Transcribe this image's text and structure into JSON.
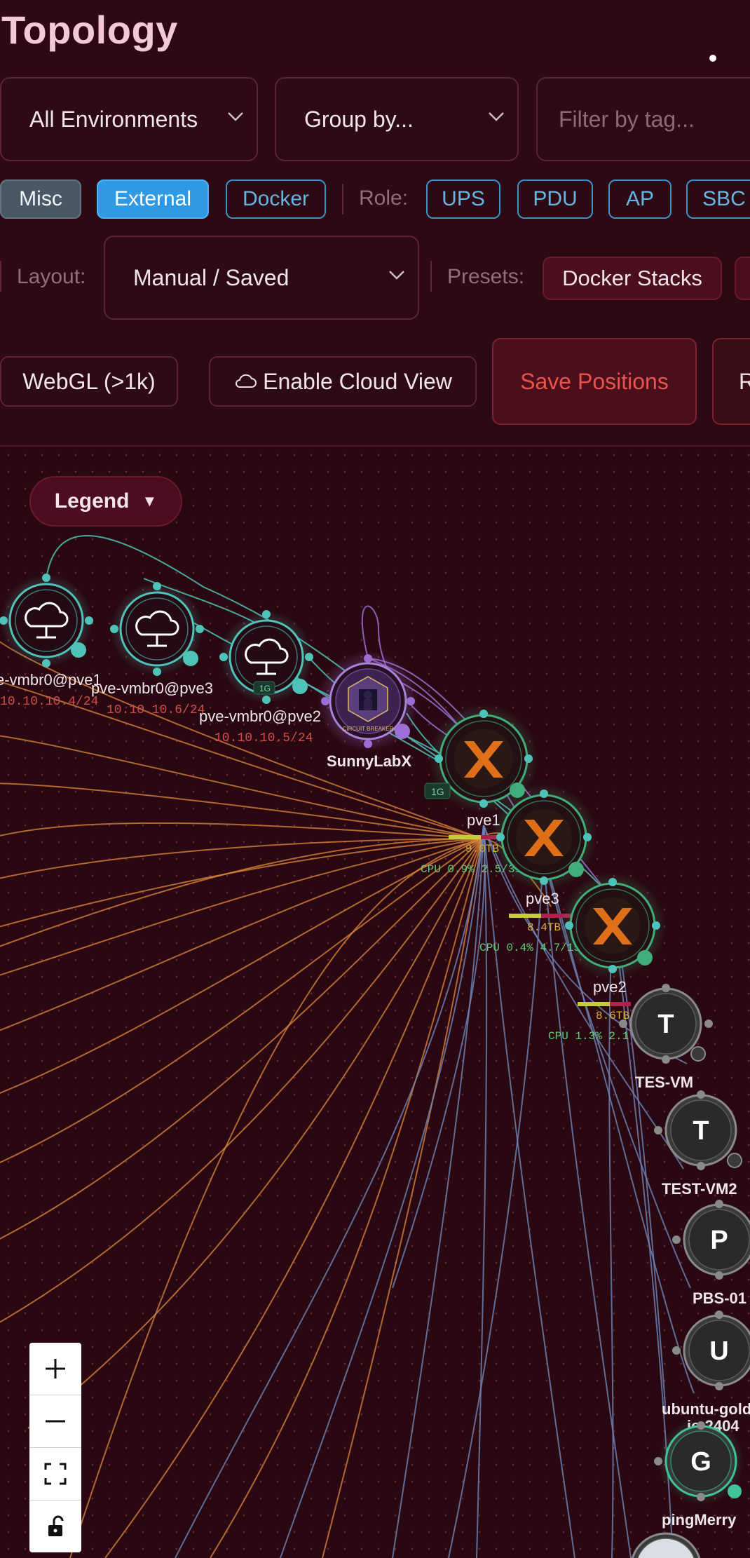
{
  "header": {
    "title": "Topology"
  },
  "filters": {
    "environment": "All Environments",
    "group_by": "Group by...",
    "tag_placeholder": "Filter by tag..."
  },
  "chips": {
    "misc": "Misc",
    "external": "External",
    "docker": "Docker",
    "role_label": "Role:",
    "roles": [
      "UPS",
      "PDU",
      "AP",
      "SBC"
    ]
  },
  "layout": {
    "label": "Layout:",
    "value": "Manual / Saved",
    "presets_label": "Presets:",
    "preset_docker": "Docker Stacks"
  },
  "actions": {
    "webgl": "WebGL (>1k)",
    "cloud": "Enable Cloud View",
    "save": "Save Positions",
    "next_partial": "R"
  },
  "legend": {
    "label": "Legend",
    "arrow": "▼"
  },
  "nodes": {
    "bridge_pve1": {
      "name": "e-vmbr0@pve1",
      "ip": "10.10.10.4/24"
    },
    "bridge_pve3": {
      "name": "pve-vmbr0@pve3",
      "ip": "10.10.10.6/24"
    },
    "bridge_pve2": {
      "name": "pve-vmbr0@pve2",
      "ip": "10.10.10.5/24",
      "badge": "1G"
    },
    "sunnylab": {
      "name": "SunnyLabX",
      "sublabel": "CIRCUIT BREAKER"
    },
    "pve1": {
      "name": "pve1",
      "badge": "1G",
      "storage": "9.0TB",
      "stats": "CPU 0.9% 2.5/31.3GB"
    },
    "pve3": {
      "name": "pve3",
      "storage": "8.4TB",
      "stats": "CPU 0.4% 4.7/15.5GB"
    },
    "pve2": {
      "name": "pve2",
      "storage": "8.6TB",
      "stats": "CPU 1.3% 2.1"
    },
    "tes_vm": {
      "letter": "T",
      "name": "TES-VM"
    },
    "test_vm2": {
      "letter": "T",
      "name": "TEST-VM2"
    },
    "pbs01": {
      "letter": "P",
      "name": "PBS-01"
    },
    "ubuntu": {
      "letter": "U",
      "name": "ubuntu-gold",
      "name2": "ie-2404"
    },
    "pingmerry": {
      "letter": "G",
      "name": "pingMerry"
    }
  },
  "colors": {
    "background": "#2a0812",
    "teal": "#4fc3b8",
    "orange": "#e08a3c",
    "blue_link": "#6e86b8",
    "purple": "#9b6fd6",
    "proxmox_orange": "#e06f1a",
    "save_red": "#e8544c",
    "external_blue": "#2e9ae6"
  }
}
